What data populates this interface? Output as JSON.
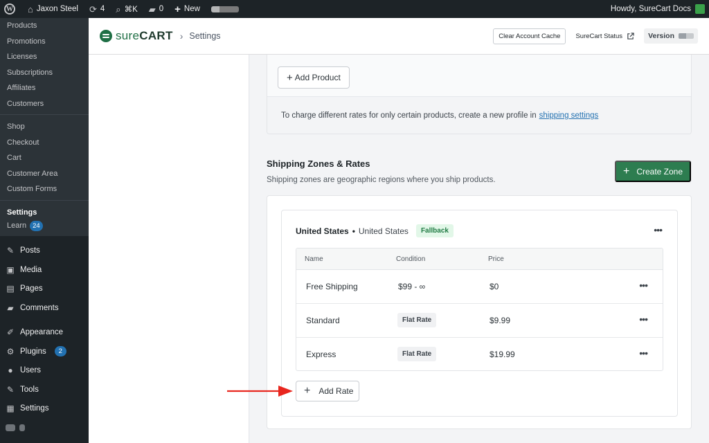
{
  "adminbar": {
    "site_name": "Jaxon Steel",
    "updates_count": "4",
    "shortcut": "⌘K",
    "comments_count": "0",
    "new_label": "New",
    "howdy": "Howdy, SureCart Docs"
  },
  "sidebar": {
    "sub_items": [
      {
        "label": "Products"
      },
      {
        "label": "Promotions"
      },
      {
        "label": "Licenses"
      },
      {
        "label": "Subscriptions"
      },
      {
        "label": "Affiliates"
      },
      {
        "label": "Customers"
      }
    ],
    "sub_items_2": [
      {
        "label": "Shop"
      },
      {
        "label": "Checkout"
      },
      {
        "label": "Cart"
      },
      {
        "label": "Customer Area"
      },
      {
        "label": "Custom Forms"
      }
    ],
    "settings_label": "Settings",
    "learn_label": "Learn",
    "learn_badge": "24",
    "menu": [
      {
        "label": "Posts",
        "icon": "pin-icon"
      },
      {
        "label": "Media",
        "icon": "media-icon"
      },
      {
        "label": "Pages",
        "icon": "pages-icon"
      },
      {
        "label": "Comments",
        "icon": "comments-icon"
      },
      {
        "label": "Appearance",
        "icon": "paintbrush-icon"
      },
      {
        "label": "Plugins",
        "icon": "plugin-icon",
        "badge": "2"
      },
      {
        "label": "Users",
        "icon": "user-icon"
      },
      {
        "label": "Tools",
        "icon": "wrench-icon"
      },
      {
        "label": "Settings",
        "icon": "settings-icon"
      }
    ]
  },
  "header": {
    "brand_light": "sure",
    "brand_bold": "CART",
    "breadcrumb": "Settings",
    "clear_cache": "Clear Account Cache",
    "status_link": "SureCart Status",
    "version_label": "Version"
  },
  "products_card": {
    "add_product": "Add Product",
    "note": "To charge different rates for only certain products, create a new profile in",
    "note_link": "shipping settings"
  },
  "zones_section": {
    "title": "Shipping Zones & Rates",
    "description": "Shipping zones are geographic regions where you ship products.",
    "create_button": "Create Zone"
  },
  "zone": {
    "name": "United States",
    "separator": "•",
    "region": "United States",
    "badge": "Fallback",
    "columns": [
      "Name",
      "Condition",
      "Price"
    ],
    "rates": [
      {
        "name": "Free Shipping",
        "condition": "$99 - ∞",
        "condition_is_tag": false,
        "price": "$0"
      },
      {
        "name": "Standard",
        "condition": "Flat Rate",
        "condition_is_tag": true,
        "price": "$9.99"
      },
      {
        "name": "Express",
        "condition": "Flat Rate",
        "condition_is_tag": true,
        "price": "$19.99"
      }
    ],
    "add_rate": "Add Rate"
  },
  "colors": {
    "primary_green": "#2d7d50",
    "annotation_arrow": "#e8261e",
    "link_blue": "#2271b1"
  }
}
